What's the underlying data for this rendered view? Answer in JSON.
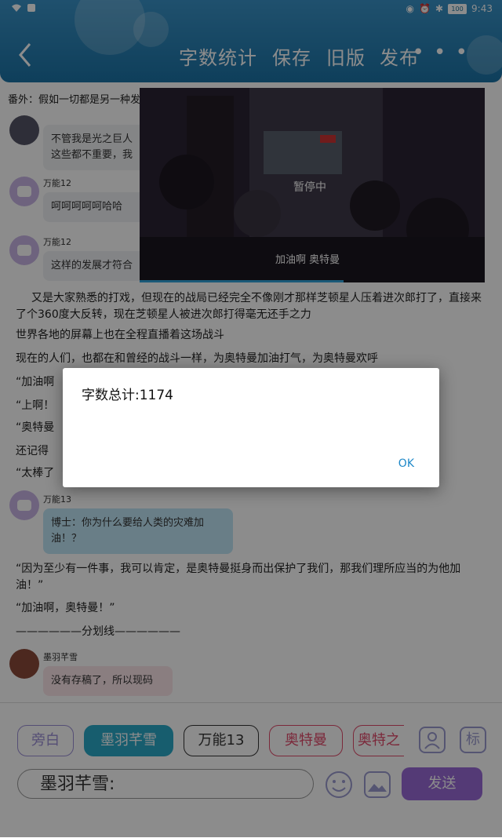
{
  "status_bar": {
    "time": "9:43",
    "battery": "100"
  },
  "toolbar": {
    "back_icon": "chevron-left-icon",
    "items": [
      "字数统计",
      "保存",
      "旧版",
      "发布"
    ],
    "more_icon": "more-dots-icon"
  },
  "chapter_title": "番外：假如一切都是另一种发",
  "chat": [
    {
      "name": "",
      "text": "不管我是光之巨人\n这些都不重要，我"
    },
    {
      "name": "万能12",
      "text": "呵呵呵呵呵哈哈"
    },
    {
      "name": "万能12",
      "text": "这样的发展才符合"
    }
  ],
  "paragraphs": [
    "又是大家熟悉的打戏，但现在的战局已经完全不像刚才那样芝顿星人压着进次郎打了，直接来了个360度大反转，现在芝顿星人被进次郎打得毫无还手之力",
    "世界各地的屏幕上也在全程直播着这场战斗",
    "现在的人们，也都在和曾经的战斗一样，为奥特曼加油打气，为奥特曼欢呼",
    "“加油啊",
    "“上啊！",
    "“奥特曼",
    "还记得",
    "“太棒了"
  ],
  "chat2": {
    "name": "万能13",
    "text": "博士：你为什么要给人类的灾难加油！？"
  },
  "paragraphs2": [
    "“因为至少有一件事，我可以肯定，是奥特曼挺身而出保护了我们，那我们理所应当的为他加油！”",
    "“加油啊，奥特曼！”",
    "——————分划线——————"
  ],
  "chat3": {
    "name": "墨羽芊雪",
    "text": "没有存稿了，所以现码"
  },
  "video": {
    "status": "暂停中",
    "caption": "加油啊 奥特曼",
    "progress": 0.59
  },
  "dialog": {
    "message": "字数总计:1174",
    "ok": "OK"
  },
  "roles": [
    {
      "label": "旁白",
      "color": "#9b8fd6",
      "selected": false
    },
    {
      "label": "墨羽芊雪",
      "color": "#2aa9c9",
      "selected": true
    },
    {
      "label": "万能13",
      "color": "#333333",
      "selected": false
    },
    {
      "label": "奥特曼",
      "color": "#e04a6a",
      "selected": false
    },
    {
      "label": "奥特之",
      "color": "#e04a6a",
      "selected": false
    }
  ],
  "input": {
    "value": "墨羽芊雪:"
  },
  "send_label": "发送",
  "tag_label": "标"
}
